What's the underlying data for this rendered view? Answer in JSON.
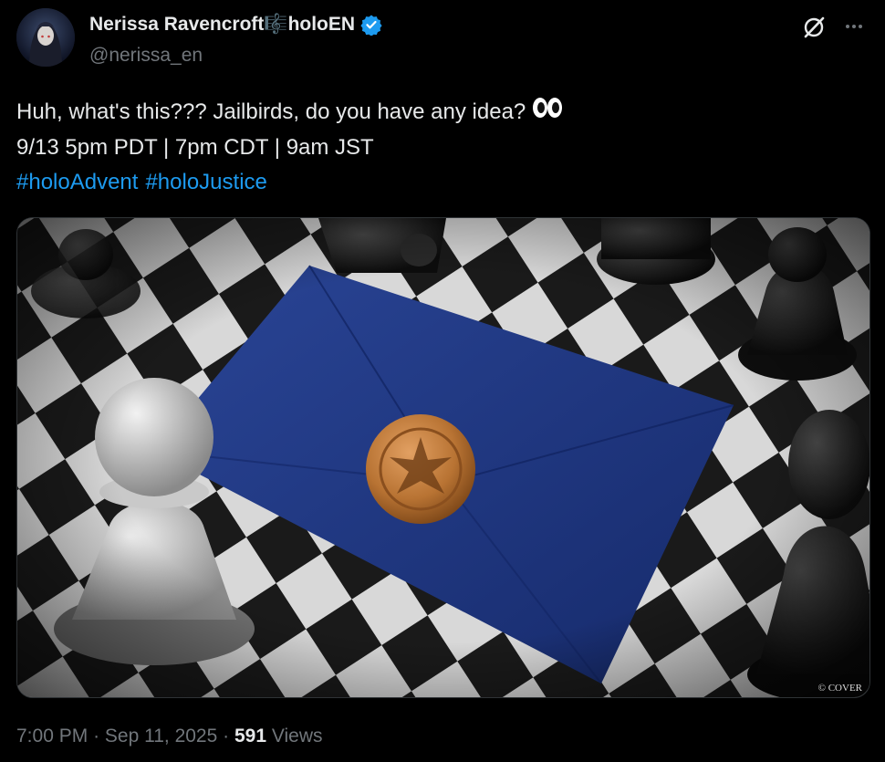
{
  "author": {
    "display_name": "Nerissa Ravencroft🎼holoEN",
    "handle": "@nerissa_en",
    "verified": true,
    "badge_color": "#1d9bf0"
  },
  "post": {
    "line1": "Huh, what's this??? Jailbirds, do you have any idea?",
    "line1_emoji": "eyes-emoji",
    "line2": "9/13 5pm PDT | 7pm CDT | 9am JST",
    "hashtags": [
      "#holoAdvent",
      "#holoJustice"
    ]
  },
  "media": {
    "credit": "© COVER",
    "envelope_color": "#1e3a8a",
    "seal_color": "#b87333"
  },
  "meta": {
    "time": "7:00 PM",
    "sep": "·",
    "date": "Sep 11, 2025",
    "views_count": "591",
    "views_label": "Views"
  },
  "icons": {
    "grok": "grok-icon",
    "more": "more-icon"
  }
}
